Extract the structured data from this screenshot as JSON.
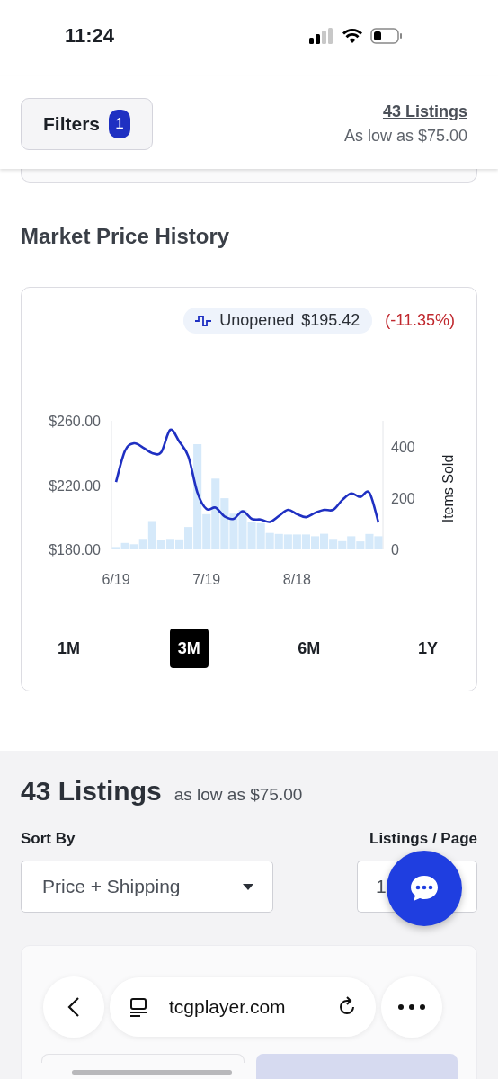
{
  "status_bar": {
    "time": "11:24"
  },
  "header": {
    "filters_label": "Filters",
    "filters_count": "1",
    "listings_link": "43 Listings",
    "low_price": "As low as $75.00"
  },
  "market_price_history": {
    "title": "Market Price History",
    "legend": {
      "price": "$195.42",
      "change": "(-11.35%)"
    },
    "price_chart": {
      "chart_data": {
        "type": "line",
        "categories": [
          "6/19",
          null,
          null,
          null,
          null,
          null,
          null,
          null,
          null,
          null,
          "7/19",
          null,
          null,
          null,
          null,
          null,
          null,
          null,
          null,
          null,
          "8/18",
          null,
          null,
          null,
          null,
          null,
          null,
          null,
          null,
          null
        ],
        "ylim": [
          180,
          260
        ],
        "yticks": [
          {
            "value": 180,
            "label": "$180.00"
          },
          {
            "value": 220,
            "label": "$220.00"
          },
          {
            "value": 260,
            "label": "$260.00"
          }
        ],
        "series": [
          {
            "name": "Unopened",
            "color": "#1f30c2",
            "values": [
              221.9,
              241.4,
              246,
              243.3,
              239.9,
              240.5,
              254.4,
              247,
              237.7,
              215.3,
              205.1,
              206,
              200.5,
              199,
              203.8,
              199,
              198.6,
              197.1,
              200.8,
              204.6,
              202,
              200.1,
              202.7,
              204.6,
              204.6,
              210.7,
              214.8,
              212.6,
              215.3,
              196.7
            ]
          }
        ]
      }
    },
    "sales_chart": {
      "chart_data": {
        "type": "bar",
        "ylabel": "Items Sold",
        "ylim": [
          0,
          500
        ],
        "yticks": [
          {
            "value": 0,
            "label": "0"
          },
          {
            "value": 200,
            "label": "200"
          },
          {
            "value": 400,
            "label": "400"
          }
        ],
        "values": [
          9,
          25,
          20,
          41,
          110,
          37,
          41,
          39,
          87,
          409,
          137,
          275,
          199,
          139,
          153,
          107,
          102,
          64,
          60,
          58,
          58,
          58,
          51,
          61,
          41,
          32,
          51,
          31,
          60,
          51
        ]
      }
    },
    "ranges": [
      {
        "label": "1M",
        "selected": false
      },
      {
        "label": "3M",
        "selected": true
      },
      {
        "label": "6M",
        "selected": false
      },
      {
        "label": "1Y",
        "selected": false
      }
    ]
  },
  "listings": {
    "title": "43 Listings",
    "subtitle": "as low as $75.00",
    "sort_label": "Sort By",
    "sort_value": "Price + Shipping",
    "per_page_label": "Listings / Page",
    "per_page_value": "1"
  },
  "browser": {
    "url": "tcgplayer.com"
  }
}
